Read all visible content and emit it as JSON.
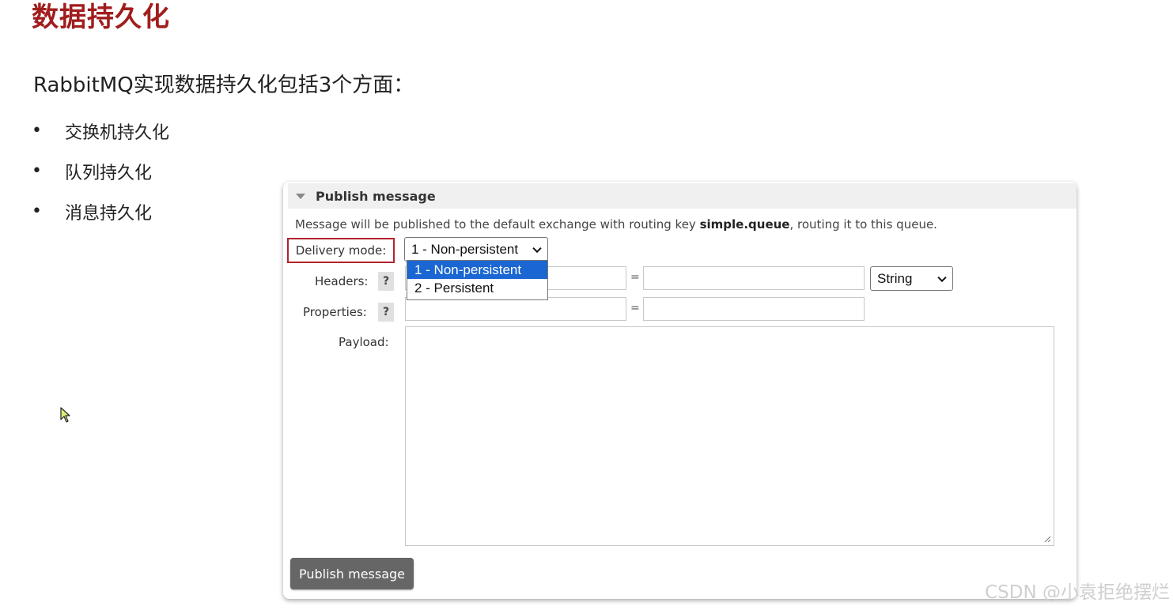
{
  "slide": {
    "title": "数据持久化",
    "subtitle": "RabbitMQ实现数据持久化包括3个方面：",
    "bullets": [
      {
        "dot": "•",
        "text": "交换机持久化"
      },
      {
        "dot": "•",
        "text": "队列持久化"
      },
      {
        "dot": "•",
        "text": "消息持久化"
      }
    ]
  },
  "panel": {
    "title": "Publish message",
    "description_prefix": "Message will be published to the default exchange with routing key ",
    "routing_key": "simple.queue",
    "description_suffix": ", routing it to this queue.",
    "delivery_mode_label": "Delivery mode:",
    "delivery_mode_value": "1 - Non-persistent",
    "delivery_mode_options": [
      "1 - Non-persistent",
      "2 - Persistent"
    ],
    "headers_label": "Headers:",
    "properties_label": "Properties:",
    "payload_label": "Payload:",
    "help_text": "?",
    "equals": "=",
    "header_type_value": "String",
    "publish_button": "Publish message"
  },
  "watermark": "CSDN @小袁拒绝摆烂",
  "colors": {
    "title_red": "#a11d1d",
    "highlight_border": "#b2232d",
    "selected_option": "#1a66d2",
    "button_gray": "#666666"
  }
}
